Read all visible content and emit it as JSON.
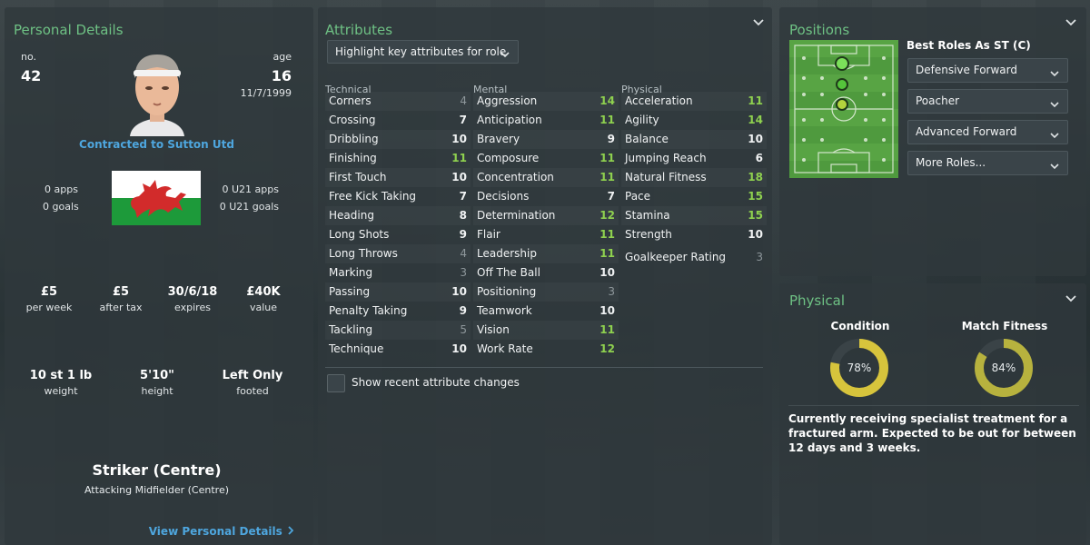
{
  "personal": {
    "title": "Personal Details",
    "no_label": "no.",
    "no_value": "42",
    "age_label": "age",
    "age_value": "16",
    "dob": "11/7/1999",
    "contract": "Contracted to Sutton Utd",
    "apps": "0 apps",
    "goals": "0 goals",
    "u21_apps": "0 U21 apps",
    "u21_goals": "0 U21 goals",
    "stats": [
      {
        "value": "£5",
        "label": "per week"
      },
      {
        "value": "£5",
        "label": "after tax"
      },
      {
        "value": "30/6/18",
        "label": "expires"
      },
      {
        "value": "£40K",
        "label": "value"
      }
    ],
    "body": [
      {
        "value": "10 st 1 lb",
        "label": "weight"
      },
      {
        "value": "5'10\"",
        "label": "height"
      },
      {
        "value": "Left Only",
        "label": "footed"
      }
    ],
    "position_main": "Striker (Centre)",
    "position_alt": "Attacking Midfielder (Centre)",
    "view_link": "View Personal Details"
  },
  "attributes": {
    "title": "Attributes",
    "highlight_dropdown": "Highlight key attributes for role",
    "technical_header": "Technical",
    "mental_header": "Mental",
    "physical_header": "Physical",
    "technical": [
      {
        "name": "Corners",
        "value": "4",
        "tone": "grey"
      },
      {
        "name": "Crossing",
        "value": "7",
        "tone": "white"
      },
      {
        "name": "Dribbling",
        "value": "10",
        "tone": "white"
      },
      {
        "name": "Finishing",
        "value": "11",
        "tone": "green"
      },
      {
        "name": "First Touch",
        "value": "10",
        "tone": "white"
      },
      {
        "name": "Free Kick Taking",
        "value": "7",
        "tone": "white"
      },
      {
        "name": "Heading",
        "value": "8",
        "tone": "white"
      },
      {
        "name": "Long Shots",
        "value": "9",
        "tone": "white"
      },
      {
        "name": "Long Throws",
        "value": "4",
        "tone": "grey"
      },
      {
        "name": "Marking",
        "value": "3",
        "tone": "grey"
      },
      {
        "name": "Passing",
        "value": "10",
        "tone": "white"
      },
      {
        "name": "Penalty Taking",
        "value": "9",
        "tone": "white"
      },
      {
        "name": "Tackling",
        "value": "5",
        "tone": "grey"
      },
      {
        "name": "Technique",
        "value": "10",
        "tone": "white"
      }
    ],
    "mental": [
      {
        "name": "Aggression",
        "value": "14",
        "tone": "green"
      },
      {
        "name": "Anticipation",
        "value": "11",
        "tone": "green"
      },
      {
        "name": "Bravery",
        "value": "9",
        "tone": "white"
      },
      {
        "name": "Composure",
        "value": "11",
        "tone": "green"
      },
      {
        "name": "Concentration",
        "value": "11",
        "tone": "green"
      },
      {
        "name": "Decisions",
        "value": "7",
        "tone": "white"
      },
      {
        "name": "Determination",
        "value": "12",
        "tone": "green"
      },
      {
        "name": "Flair",
        "value": "11",
        "tone": "green"
      },
      {
        "name": "Leadership",
        "value": "11",
        "tone": "green"
      },
      {
        "name": "Off The Ball",
        "value": "10",
        "tone": "white"
      },
      {
        "name": "Positioning",
        "value": "3",
        "tone": "grey"
      },
      {
        "name": "Teamwork",
        "value": "10",
        "tone": "white"
      },
      {
        "name": "Vision",
        "value": "11",
        "tone": "green"
      },
      {
        "name": "Work Rate",
        "value": "12",
        "tone": "green"
      }
    ],
    "physical": [
      {
        "name": "Acceleration",
        "value": "11",
        "tone": "green"
      },
      {
        "name": "Agility",
        "value": "14",
        "tone": "green"
      },
      {
        "name": "Balance",
        "value": "10",
        "tone": "white"
      },
      {
        "name": "Jumping Reach",
        "value": "6",
        "tone": "white"
      },
      {
        "name": "Natural Fitness",
        "value": "18",
        "tone": "green"
      },
      {
        "name": "Pace",
        "value": "15",
        "tone": "green"
      },
      {
        "name": "Stamina",
        "value": "15",
        "tone": "green"
      },
      {
        "name": "Strength",
        "value": "10",
        "tone": "white"
      }
    ],
    "goalkeeper_label": "Goalkeeper Rating",
    "goalkeeper_value": "3",
    "recent_changes_label": "Show recent attribute changes"
  },
  "positions": {
    "title": "Positions",
    "best_roles_label": "Best Roles As ST (C)",
    "roles": [
      "Defensive Forward",
      "Poacher",
      "Advanced Forward",
      "More Roles..."
    ]
  },
  "physical_panel": {
    "title": "Physical",
    "condition_label": "Condition",
    "condition_value": "78%",
    "condition_fraction": 0.78,
    "fitness_label": "Match Fitness",
    "fitness_value": "84%",
    "fitness_fraction": 0.84,
    "injury_text": "Currently receiving specialist treatment for a fractured arm. Expected to be out for between 12 days and 3 weeks."
  },
  "colors": {
    "title_green": "#6ec184",
    "link_blue": "#4ea6de",
    "attr_green": "#8fd14f",
    "ring_yellow": "#d7c43c",
    "ring_track": "#3a4347"
  }
}
